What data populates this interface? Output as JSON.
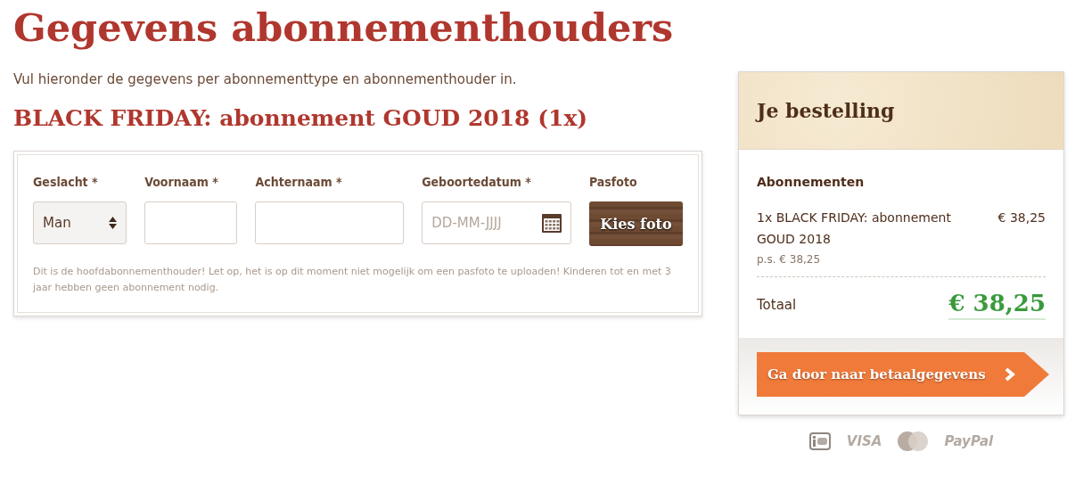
{
  "page": {
    "title": "Gegevens abonnementhouders",
    "intro": "Vul hieronder de gegevens per abonnementtype en abonnementhouder in."
  },
  "subscription": {
    "title": "BLACK FRIDAY: abonnement GOUD 2018 (1x)",
    "fields": [
      {
        "kind": "select",
        "label": "Geslacht *",
        "value": "Man"
      },
      {
        "kind": "text",
        "label": "Voornaam *"
      },
      {
        "kind": "text",
        "label": "Achternaam *"
      },
      {
        "kind": "date",
        "label": "Geboortedatum *",
        "placeholder": "DD-MM-JJJJ"
      },
      {
        "kind": "photo",
        "label": "Pasfoto",
        "button": "Kies foto"
      }
    ],
    "note": "Dit is de hoofdabonnementhouder! Let op, het is op dit moment niet mogelijk om een pasfoto te uploaden! Kinderen tot en met 3 jaar hebben geen abonnement nodig."
  },
  "order": {
    "title": "Je bestelling",
    "section": "Abonnementen",
    "items": [
      {
        "name": "1x BLACK FRIDAY: abonnement GOUD 2018",
        "price": "€ 38,25",
        "detail": "p.s. € 38,25"
      }
    ],
    "total_label": "Totaal",
    "total": "€ 38,25",
    "button": "Ga door naar betaalgegevens"
  },
  "payment_methods": [
    {
      "kind": "ideal"
    },
    {
      "kind": "text",
      "label": "VISA"
    },
    {
      "kind": "mastercard"
    },
    {
      "kind": "text",
      "label": "PayPal"
    }
  ]
}
